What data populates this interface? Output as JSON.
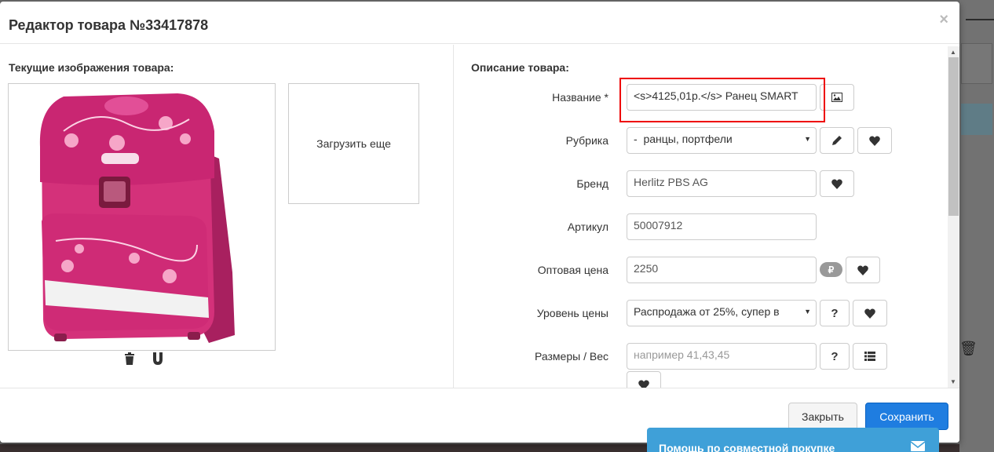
{
  "modal": {
    "title": "Редактор товара №33417878",
    "close_symbol": "×"
  },
  "images": {
    "section_title": "Текущие изображения товара:",
    "upload_label": "Загрузить еще"
  },
  "form": {
    "section_title": "Описание товара:",
    "name": {
      "label": "Название *",
      "value": "<s>4125,01р.</s> Ранец SMART"
    },
    "category": {
      "label": "Рубрика",
      "value": "-  ранцы, портфели"
    },
    "brand": {
      "label": "Бренд",
      "value": "Herlitz PBS AG"
    },
    "article": {
      "label": "Артикул",
      "value": "50007912"
    },
    "wholesale_price": {
      "label": "Оптовая цена",
      "value": "2250",
      "currency": "₽"
    },
    "price_level": {
      "label": "Уровень цены",
      "value": "Распродажа от 25%, супер в",
      "help": "?"
    },
    "sizes": {
      "label": "Размеры / Вес",
      "placeholder": "например 41,43,45",
      "help": "?"
    }
  },
  "footer": {
    "close_label": "Закрыть",
    "save_label": "Сохранить"
  },
  "help_widget": {
    "label": "Помощь по совместной покупке"
  },
  "colors": {
    "primary": "#1f7de0",
    "highlight": "#e00000",
    "widget": "#3fa0d8",
    "product": "#d4317a"
  }
}
